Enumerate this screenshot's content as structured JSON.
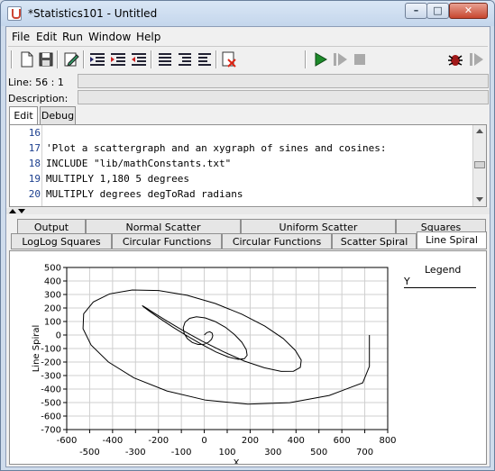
{
  "window": {
    "title": "*Statistics101 - Untitled",
    "min_glyph": "–",
    "max_glyph": "□",
    "close_glyph": "✕"
  },
  "menu": [
    "File",
    "Edit",
    "Run",
    "Window",
    "Help"
  ],
  "toolbar": {
    "icons": [
      "new-file-icon",
      "save-icon",
      "edit-icon",
      "indent-icon",
      "indent-selected-icon",
      "outdent-icon",
      "list-icon",
      "list-indent-icon",
      "list-outdent-icon",
      "clear-output-icon",
      "run-icon",
      "step-icon",
      "stop-icon",
      "debug-bug-icon",
      "debug-step-icon"
    ]
  },
  "status": {
    "line_label": "Line: 56 : 1",
    "description_label": "Description:"
  },
  "edit_tabs": [
    "Edit",
    "Debug"
  ],
  "editor": {
    "lines": [
      {
        "num": "16",
        "text": ""
      },
      {
        "num": "17",
        "text": "'Plot a scattergraph and an xygraph of sines and cosines:"
      },
      {
        "num": "18",
        "text": "INCLUDE \"lib/mathConstants.txt\""
      },
      {
        "num": "19",
        "text": "MULTIPLY 1,180 5 degrees"
      },
      {
        "num": "20",
        "text": "MULTIPLY degrees degToRad radians"
      }
    ]
  },
  "output_tabs_row1": [
    "Output",
    "Normal Scatter",
    "Uniform Scatter",
    "Squares"
  ],
  "output_tabs_row2": [
    "LogLog Squares",
    "Circular Functions",
    "Circular Functions",
    "Scatter Spiral",
    "Line Spiral"
  ],
  "active_output_tab": "Line Spiral",
  "chart_data": {
    "type": "line",
    "title": "",
    "xlabel": "X",
    "ylabel": "Line Spiral",
    "xlim": [
      -600,
      800
    ],
    "ylim": [
      -700,
      500
    ],
    "x_ticks_upper": [
      "-600",
      "-400",
      "-200",
      "0",
      "200",
      "400",
      "600",
      "800"
    ],
    "x_ticks_lower": [
      "-500",
      "-300",
      "-100",
      "100",
      "300",
      "500",
      "700"
    ],
    "y_ticks": [
      "500",
      "400",
      "300",
      "200",
      "100",
      "0",
      "-100",
      "-200",
      "-300",
      "-400",
      "-500",
      "-600",
      "-700"
    ],
    "grid": true,
    "legend": {
      "title": "Legend",
      "position": "right",
      "entries": [
        "Y"
      ]
    },
    "series": [
      {
        "x": [
          0,
          11,
          24,
          34,
          37,
          32,
          18,
          -2,
          -27,
          -52,
          -74,
          -88,
          -92,
          -84,
          -64,
          -34,
          4,
          47,
          92,
          132,
          164,
          183,
          187,
          175,
          147,
          105,
          51,
          -11,
          -76,
          -139,
          -195,
          -238,
          -264,
          -271,
          -256,
          -220,
          -164,
          -92,
          -8,
          84,
          175,
          262,
          335,
          389,
          419,
          423,
          397,
          344,
          264,
          164,
          48,
          -75,
          -199,
          -314,
          -413,
          -484,
          -526,
          -529,
          -494,
          -418,
          -307,
          -163,
          6,
          190,
          373,
          545,
          691,
          720,
          720
        ],
        "y": [
          0,
          18,
          24,
          15,
          -6,
          -31,
          -54,
          -69,
          -70,
          -55,
          -27,
          12,
          54,
          94,
          123,
          135,
          127,
          100,
          57,
          3,
          -54,
          -108,
          -150,
          -175,
          -180,
          -163,
          -125,
          -70,
          -5,
          61,
          124,
          175,
          208,
          218,
          203,
          164,
          105,
          32,
          -46,
          -124,
          -193,
          -243,
          -269,
          -268,
          -239,
          -186,
          -113,
          -25,
          66,
          154,
          233,
          294,
          329,
          333,
          305,
          245,
          157,
          47,
          -74,
          -200,
          -317,
          -414,
          -482,
          -512,
          -501,
          -447,
          -354,
          -232,
          0
        ]
      }
    ]
  }
}
